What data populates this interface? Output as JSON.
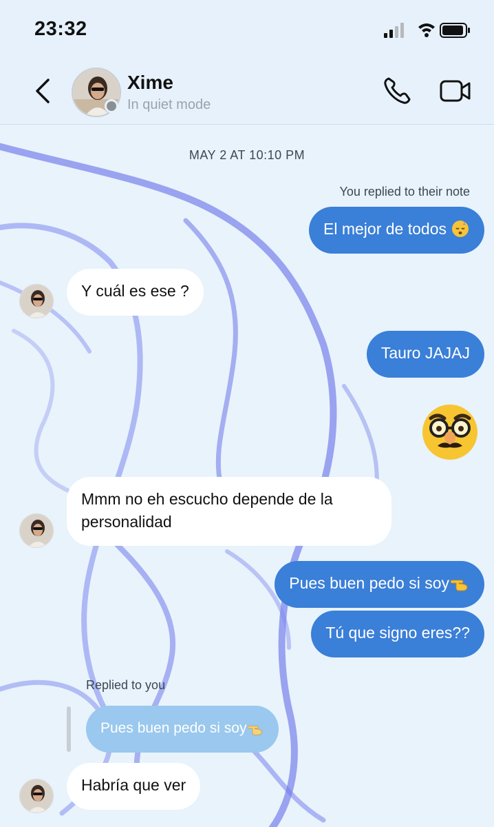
{
  "status_bar": {
    "time": "23:32"
  },
  "header": {
    "contact_name": "Xime",
    "contact_status": "In quiet mode"
  },
  "chat": {
    "date_label": "MAY 2 AT 10:10 PM",
    "note_reply_label": "You replied to their note",
    "reply_label": "Replied to you",
    "messages": [
      {
        "text": "El mejor de todos",
        "emoji": "sleeping-face-emoji"
      },
      {
        "text": "Y cuál es ese ?"
      },
      {
        "text": "Tauro JAJAJ"
      },
      {
        "emoji": "disguised-face-emoji"
      },
      {
        "text_line1": "Mmm no eh escucho depende de la",
        "text_line2": "personalidad"
      },
      {
        "text": "Pues buen pedo si soy",
        "emoji": "pointing-hand-emoji"
      },
      {
        "text": "Tú que signo eres??"
      },
      {
        "quoted_text": "Pues buen pedo si soy",
        "emoji": "pointing-hand-emoji"
      },
      {
        "text": "Habría que ver"
      }
    ]
  },
  "colors": {
    "outgoing_bubble": "#3a7fd8",
    "incoming_bubble": "#ffffff",
    "quoted_bubble": "#9ac8ee",
    "background": "#e6f1fb",
    "accent_swirl": "#5a63e6"
  }
}
